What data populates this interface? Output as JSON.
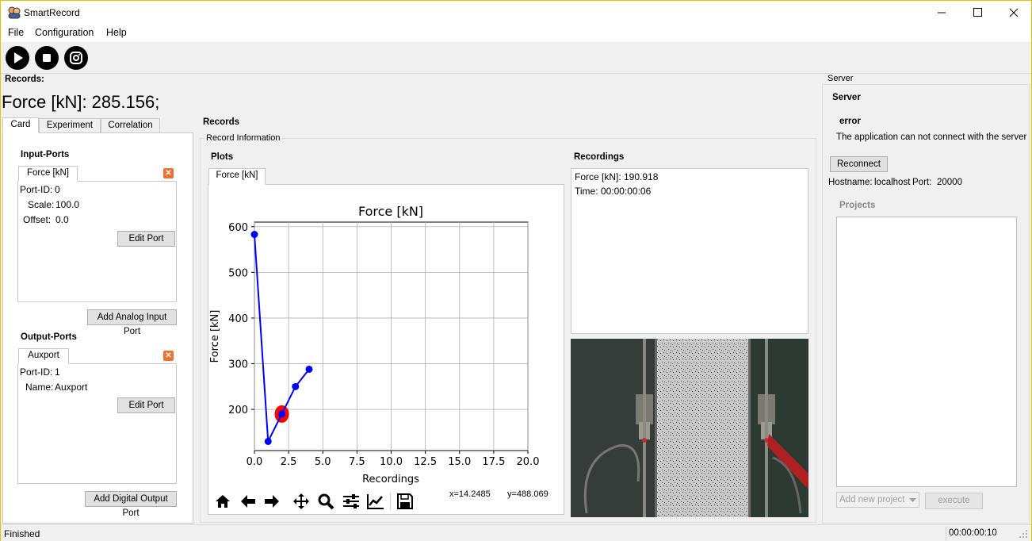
{
  "window": {
    "title": "SmartRecord"
  },
  "menu": [
    "File",
    "Configuration",
    "Help"
  ],
  "toolbar": {
    "play": "play-icon",
    "stop": "stop-icon",
    "camera": "camera-icon"
  },
  "records_header": "Records:",
  "force_readout": "Force [kN]: 285.156;",
  "left_tabs": [
    "Card",
    "Experiment",
    "Correlation"
  ],
  "input_ports": {
    "title": "Input-Ports",
    "tab": "Force [kN]",
    "port_id_label": "Port-ID:",
    "port_id": "0",
    "scale_label": "Scale:",
    "scale": "100.0",
    "offset_label": "Offset:",
    "offset": "0.0",
    "edit": "Edit Port",
    "add": "Add Analog Input Port"
  },
  "output_ports": {
    "title": "Output-Ports",
    "tab": "Auxport",
    "port_id_label": "Port-ID:",
    "port_id": "1",
    "name_label": "Name:",
    "name": "Auxport",
    "edit": "Edit Port",
    "add": "Add Digital Output Port"
  },
  "center": {
    "records_title": "Records",
    "record_info": "Record Information",
    "plots_title": "Plots",
    "plot_tab": "Force [kN]",
    "recordings_title": "Recordings",
    "recording_lines": [
      "Force [kN]: 190.918",
      "Time: 00:00:00:06"
    ],
    "coords": {
      "x": "x=14.2485",
      "y": "y=488.069"
    }
  },
  "chart_data": {
    "type": "line",
    "title": "Force [kN]",
    "xlabel": "Recordings",
    "ylabel": "Force [kN]",
    "x": [
      0,
      1,
      2,
      3,
      4
    ],
    "y": [
      583,
      130,
      190,
      250,
      288
    ],
    "highlight": {
      "x": 2,
      "y": 190
    },
    "xlim": [
      0,
      20
    ],
    "ylim": [
      110,
      610
    ],
    "xticks": [
      0.0,
      2.5,
      5.0,
      7.5,
      10.0,
      12.5,
      15.0,
      17.5,
      20.0
    ],
    "xtick_labels": [
      "0.0",
      "2.5",
      "5.0",
      "7.5",
      "10.0",
      "12.5",
      "15.0",
      "17.5",
      "20.0"
    ],
    "yticks": [
      200,
      300,
      400,
      500,
      600
    ],
    "ytick_labels": [
      "200",
      "300",
      "400",
      "500",
      "600"
    ],
    "grid": true,
    "line_color": "#0000ff",
    "highlight_color": "#ff0000"
  },
  "plot_toolbar": [
    "home-icon",
    "back-arrow-icon",
    "forward-arrow-icon",
    "pan-icon",
    "zoom-icon",
    "settings-sliders-icon",
    "edit-axes-icon",
    "save-icon"
  ],
  "server": {
    "group": "Server",
    "title": "Server",
    "error_title": "error",
    "error_msg": "The application can not connect with the server",
    "reconnect": "Reconnect",
    "hostname_label": "Hostname:",
    "hostname": "localhost",
    "port_label": "Port:",
    "port": "20000",
    "projects_title": "Projects",
    "add_project": "Add new project",
    "execute": "execute"
  },
  "status": {
    "left": "Finished",
    "time": "00:00:00:10"
  }
}
